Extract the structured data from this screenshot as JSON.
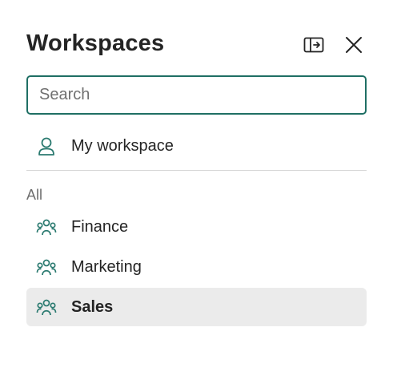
{
  "header": {
    "title": "Workspaces",
    "pin_icon": "panel-dock-icon",
    "close_icon": "close-icon"
  },
  "search": {
    "placeholder": "Search",
    "value": ""
  },
  "my_workspace": {
    "label": "My workspace",
    "icon": "person-icon"
  },
  "section": {
    "label": "All"
  },
  "workspaces": [
    {
      "label": "Finance",
      "icon": "people-team-icon",
      "selected": false
    },
    {
      "label": "Marketing",
      "icon": "people-team-icon",
      "selected": false
    },
    {
      "label": "Sales",
      "icon": "people-team-icon",
      "selected": true
    }
  ],
  "colors": {
    "accent": "#1f6f64",
    "icon_teal": "#2b7a70",
    "selected_bg": "#ebebeb",
    "divider": "#d6d6d6"
  }
}
